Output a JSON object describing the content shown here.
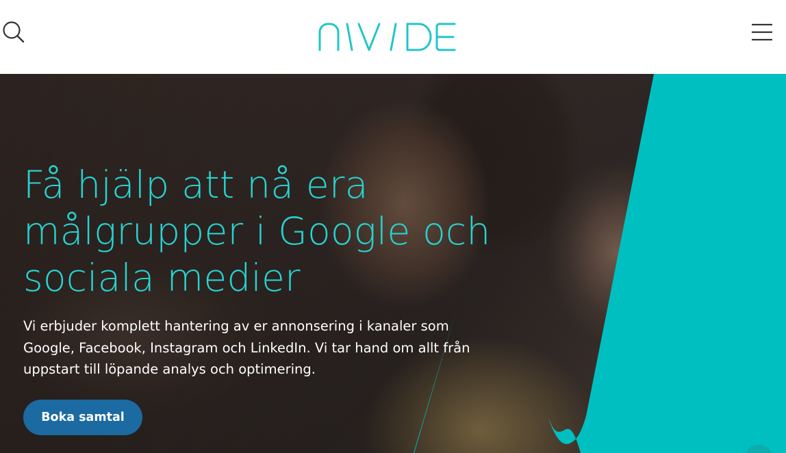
{
  "header": {
    "logo_text": "NIVIDE",
    "search_icon": "search-icon",
    "menu_icon": "hamburger-menu-icon"
  },
  "hero": {
    "title": "Få hjälp att nå era målgrupper i Google och sociala medier",
    "description": "Vi erbjuder komplett hantering av er annonsering i kanaler som Google, Facebook, Instagram och LinkedIn. Vi tar hand om allt från uppstart till löpande analys och optimering.",
    "cta_label": "Boka samtal"
  },
  "colors": {
    "brand_teal": "#21c5c9",
    "shape_teal": "#00bfc1",
    "cta_blue": "#1b6aa1"
  }
}
